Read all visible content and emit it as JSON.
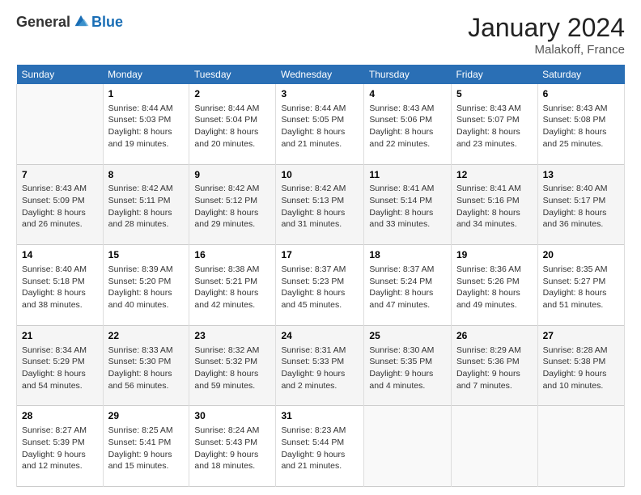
{
  "header": {
    "logo_general": "General",
    "logo_blue": "Blue",
    "month_title": "January 2024",
    "subtitle": "Malakoff, France"
  },
  "columns": [
    "Sunday",
    "Monday",
    "Tuesday",
    "Wednesday",
    "Thursday",
    "Friday",
    "Saturday"
  ],
  "weeks": [
    {
      "days": [
        {
          "number": "",
          "info": ""
        },
        {
          "number": "1",
          "info": "Sunrise: 8:44 AM\nSunset: 5:03 PM\nDaylight: 8 hours\nand 19 minutes."
        },
        {
          "number": "2",
          "info": "Sunrise: 8:44 AM\nSunset: 5:04 PM\nDaylight: 8 hours\nand 20 minutes."
        },
        {
          "number": "3",
          "info": "Sunrise: 8:44 AM\nSunset: 5:05 PM\nDaylight: 8 hours\nand 21 minutes."
        },
        {
          "number": "4",
          "info": "Sunrise: 8:43 AM\nSunset: 5:06 PM\nDaylight: 8 hours\nand 22 minutes."
        },
        {
          "number": "5",
          "info": "Sunrise: 8:43 AM\nSunset: 5:07 PM\nDaylight: 8 hours\nand 23 minutes."
        },
        {
          "number": "6",
          "info": "Sunrise: 8:43 AM\nSunset: 5:08 PM\nDaylight: 8 hours\nand 25 minutes."
        }
      ]
    },
    {
      "days": [
        {
          "number": "7",
          "info": "Sunrise: 8:43 AM\nSunset: 5:09 PM\nDaylight: 8 hours\nand 26 minutes."
        },
        {
          "number": "8",
          "info": "Sunrise: 8:42 AM\nSunset: 5:11 PM\nDaylight: 8 hours\nand 28 minutes."
        },
        {
          "number": "9",
          "info": "Sunrise: 8:42 AM\nSunset: 5:12 PM\nDaylight: 8 hours\nand 29 minutes."
        },
        {
          "number": "10",
          "info": "Sunrise: 8:42 AM\nSunset: 5:13 PM\nDaylight: 8 hours\nand 31 minutes."
        },
        {
          "number": "11",
          "info": "Sunrise: 8:41 AM\nSunset: 5:14 PM\nDaylight: 8 hours\nand 33 minutes."
        },
        {
          "number": "12",
          "info": "Sunrise: 8:41 AM\nSunset: 5:16 PM\nDaylight: 8 hours\nand 34 minutes."
        },
        {
          "number": "13",
          "info": "Sunrise: 8:40 AM\nSunset: 5:17 PM\nDaylight: 8 hours\nand 36 minutes."
        }
      ]
    },
    {
      "days": [
        {
          "number": "14",
          "info": "Sunrise: 8:40 AM\nSunset: 5:18 PM\nDaylight: 8 hours\nand 38 minutes."
        },
        {
          "number": "15",
          "info": "Sunrise: 8:39 AM\nSunset: 5:20 PM\nDaylight: 8 hours\nand 40 minutes."
        },
        {
          "number": "16",
          "info": "Sunrise: 8:38 AM\nSunset: 5:21 PM\nDaylight: 8 hours\nand 42 minutes."
        },
        {
          "number": "17",
          "info": "Sunrise: 8:37 AM\nSunset: 5:23 PM\nDaylight: 8 hours\nand 45 minutes."
        },
        {
          "number": "18",
          "info": "Sunrise: 8:37 AM\nSunset: 5:24 PM\nDaylight: 8 hours\nand 47 minutes."
        },
        {
          "number": "19",
          "info": "Sunrise: 8:36 AM\nSunset: 5:26 PM\nDaylight: 8 hours\nand 49 minutes."
        },
        {
          "number": "20",
          "info": "Sunrise: 8:35 AM\nSunset: 5:27 PM\nDaylight: 8 hours\nand 51 minutes."
        }
      ]
    },
    {
      "days": [
        {
          "number": "21",
          "info": "Sunrise: 8:34 AM\nSunset: 5:29 PM\nDaylight: 8 hours\nand 54 minutes."
        },
        {
          "number": "22",
          "info": "Sunrise: 8:33 AM\nSunset: 5:30 PM\nDaylight: 8 hours\nand 56 minutes."
        },
        {
          "number": "23",
          "info": "Sunrise: 8:32 AM\nSunset: 5:32 PM\nDaylight: 8 hours\nand 59 minutes."
        },
        {
          "number": "24",
          "info": "Sunrise: 8:31 AM\nSunset: 5:33 PM\nDaylight: 9 hours\nand 2 minutes."
        },
        {
          "number": "25",
          "info": "Sunrise: 8:30 AM\nSunset: 5:35 PM\nDaylight: 9 hours\nand 4 minutes."
        },
        {
          "number": "26",
          "info": "Sunrise: 8:29 AM\nSunset: 5:36 PM\nDaylight: 9 hours\nand 7 minutes."
        },
        {
          "number": "27",
          "info": "Sunrise: 8:28 AM\nSunset: 5:38 PM\nDaylight: 9 hours\nand 10 minutes."
        }
      ]
    },
    {
      "days": [
        {
          "number": "28",
          "info": "Sunrise: 8:27 AM\nSunset: 5:39 PM\nDaylight: 9 hours\nand 12 minutes."
        },
        {
          "number": "29",
          "info": "Sunrise: 8:25 AM\nSunset: 5:41 PM\nDaylight: 9 hours\nand 15 minutes."
        },
        {
          "number": "30",
          "info": "Sunrise: 8:24 AM\nSunset: 5:43 PM\nDaylight: 9 hours\nand 18 minutes."
        },
        {
          "number": "31",
          "info": "Sunrise: 8:23 AM\nSunset: 5:44 PM\nDaylight: 9 hours\nand 21 minutes."
        },
        {
          "number": "",
          "info": ""
        },
        {
          "number": "",
          "info": ""
        },
        {
          "number": "",
          "info": ""
        }
      ]
    }
  ]
}
